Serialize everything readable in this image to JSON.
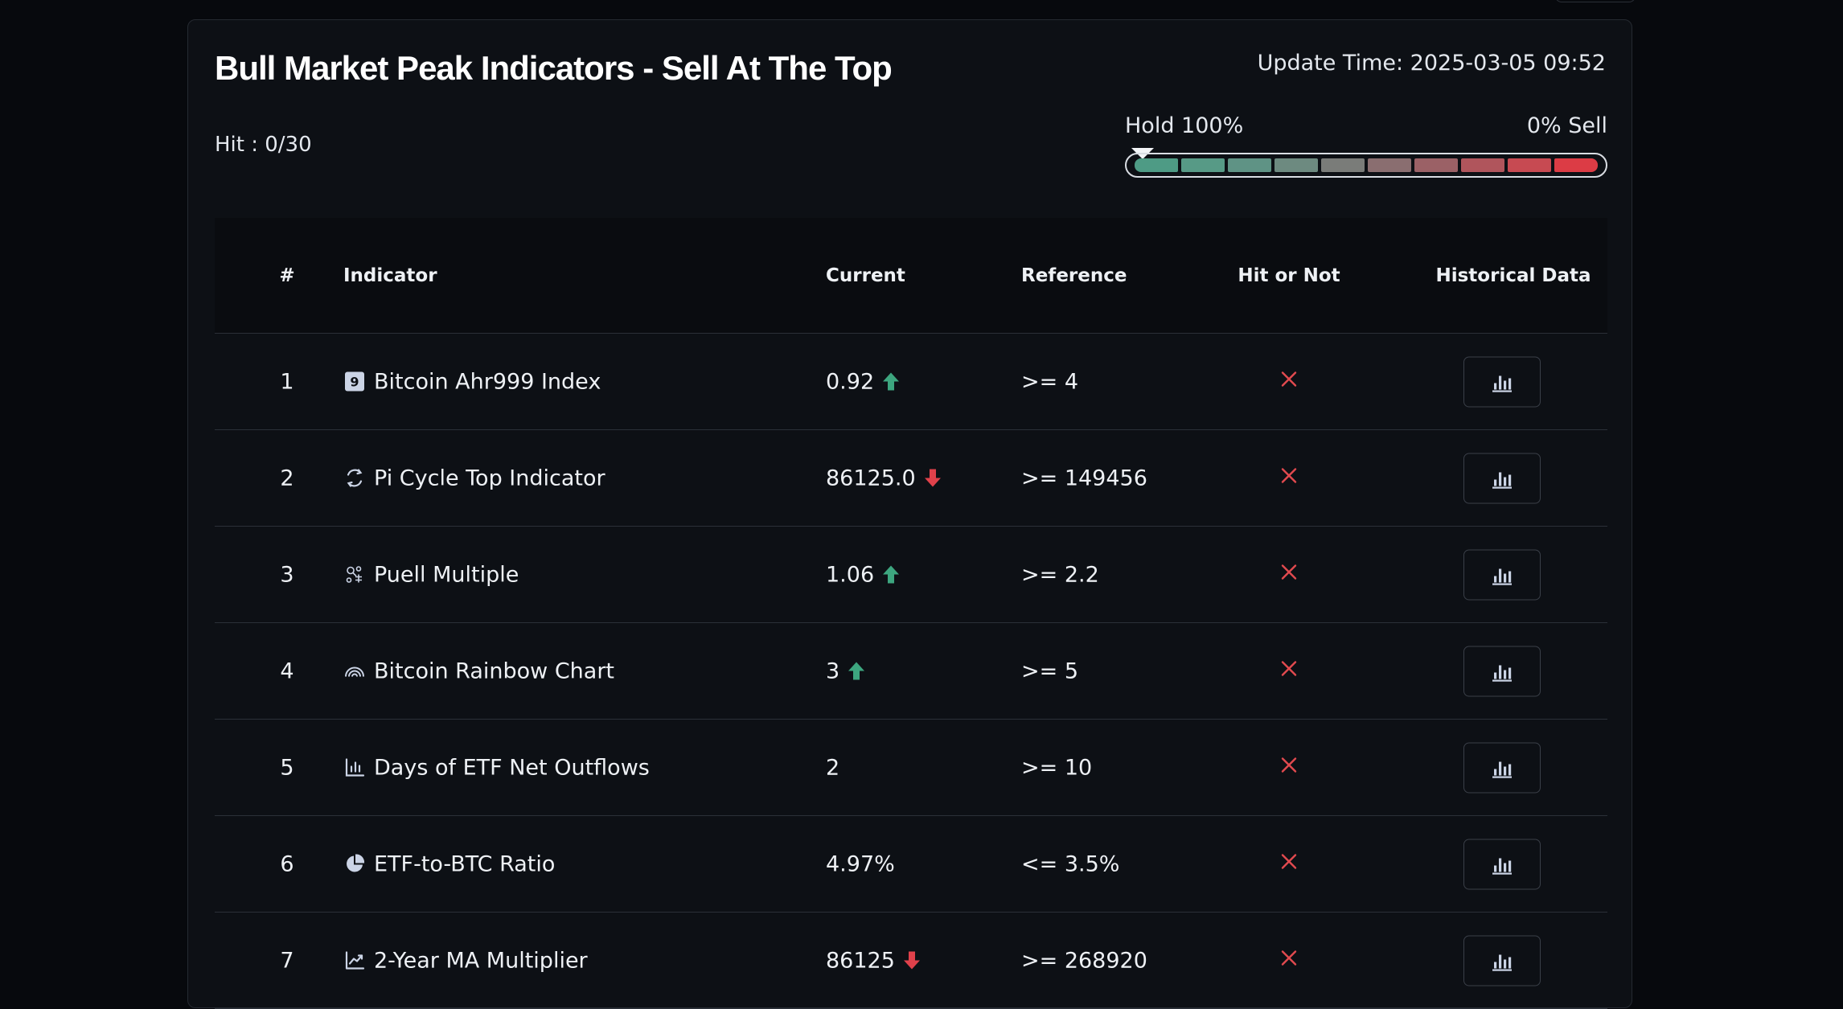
{
  "header": {
    "title": "Bull Market Peak Indicators - Sell At The Top",
    "update_time": "Update Time: 2025-03-05 09:52",
    "hit": "Hit : 0/30"
  },
  "gauge": {
    "left_label": "Hold 100%",
    "right_label": "0% Sell",
    "position_fraction": 0.0,
    "segment_colors": [
      "#4e9b85",
      "#579a86",
      "#5f9385",
      "#6d8a80",
      "#7a7c79",
      "#8a6e70",
      "#9b6166",
      "#b0555c",
      "#c74a52",
      "#dc3c45"
    ]
  },
  "table": {
    "headers": {
      "num": "#",
      "indicator": "Indicator",
      "current": "Current",
      "reference": "Reference",
      "hit": "Hit or Not",
      "historical": "Historical Data"
    },
    "rows": [
      {
        "num": "1",
        "icon": "ahr999-icon",
        "indicator": "Bitcoin Ahr999 Index",
        "current": "0.92",
        "trend": "up",
        "reference": ">= 4",
        "hit": false
      },
      {
        "num": "2",
        "icon": "pi-cycle-icon",
        "indicator": "Pi Cycle Top Indicator",
        "current": "86125.0",
        "trend": "down",
        "reference": ">= 149456",
        "hit": false
      },
      {
        "num": "3",
        "icon": "puell-icon",
        "indicator": "Puell Multiple",
        "current": "1.06",
        "trend": "up",
        "reference": ">= 2.2",
        "hit": false
      },
      {
        "num": "4",
        "icon": "rainbow-icon",
        "indicator": "Bitcoin Rainbow Chart",
        "current": "3",
        "trend": "up",
        "reference": ">= 5",
        "hit": false
      },
      {
        "num": "5",
        "icon": "bar-chart-icon",
        "indicator": "Days of ETF Net Outflows",
        "current": "2",
        "trend": "none",
        "reference": ">= 10",
        "hit": false
      },
      {
        "num": "6",
        "icon": "pie-chart-icon",
        "indicator": "ETF-to-BTC Ratio",
        "current": "4.97%",
        "trend": "none",
        "reference": "<= 3.5%",
        "hit": false
      },
      {
        "num": "7",
        "icon": "trend-line-icon",
        "indicator": "2-Year MA Multiplier",
        "current": "86125",
        "trend": "down",
        "reference": ">= 268920",
        "hit": false
      }
    ]
  },
  "colors": {
    "up": "#3da67f",
    "down": "#e0414b",
    "miss": "#e24a4f",
    "icon": "#cbd4e6"
  }
}
